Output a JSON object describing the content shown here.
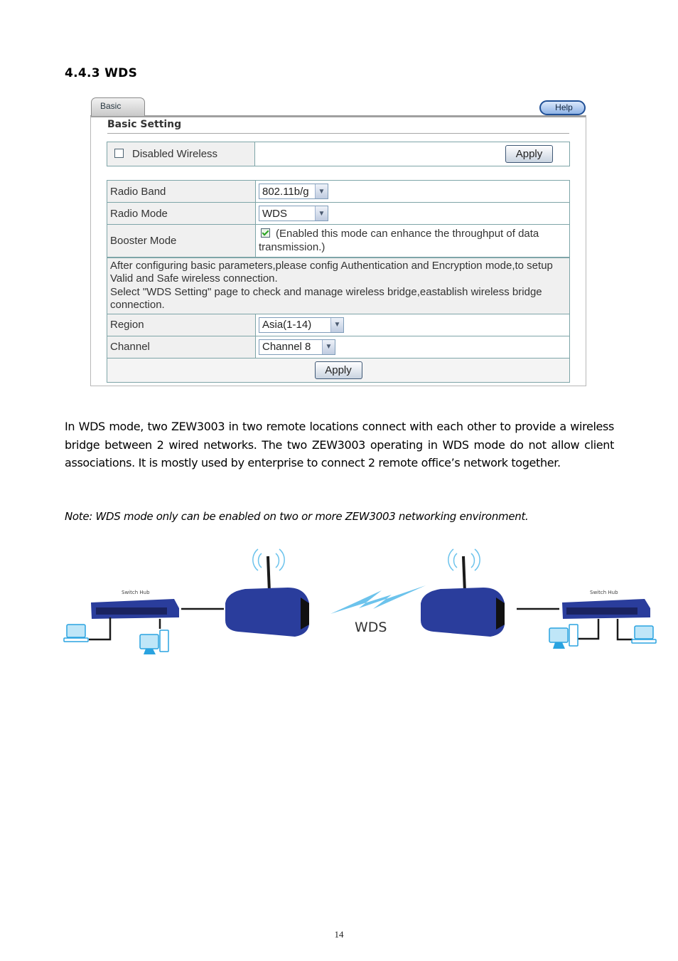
{
  "document": {
    "heading": "4.4.3 WDS",
    "page_number": "14"
  },
  "ui": {
    "tabs": [
      {
        "label": "Basic",
        "active": true
      }
    ],
    "help_label": "Help",
    "section_title": "Basic Setting",
    "disabled_wireless": {
      "label": "Disabled Wireless",
      "checked": false,
      "apply_label": "Apply"
    },
    "rows": {
      "radio_band": {
        "label": "Radio Band",
        "value": "802.11b/g"
      },
      "radio_mode": {
        "label": "Radio Mode",
        "value": "WDS"
      },
      "booster_mode": {
        "label": "Booster Mode",
        "checked": true,
        "description": "(Enabled this mode can enhance the throughput of data transmission.)"
      },
      "info_text_1": "After configuring basic parameters,please config Authentication and Encryption mode,to setup Valid and Safe wireless connection.",
      "info_text_2": "Select \"WDS Setting\" page to check and manage wireless bridge,eastablish wireless bridge connection.",
      "region": {
        "label": "Region",
        "value": "Asia(1-14)"
      },
      "channel": {
        "label": "Channel",
        "value": "Channel 8"
      }
    },
    "apply_label": "Apply"
  },
  "text": {
    "paragraph": "In WDS mode, two ZEW3003 in two remote locations connect with each other to provide a wireless bridge between 2 wired networks. The two ZEW3003 operating in WDS mode do not allow client associations. It is mostly used by enterprise to connect 2 remote office’s network together.",
    "note": "Note: WDS mode only can be enabled on two or more ZEW3003 networking environment."
  },
  "diagram": {
    "left_hub_label": "Switch Hub",
    "right_hub_label": "Switch Hub",
    "link_label": "WDS",
    "colors": {
      "device_blue": "#2a3d9c",
      "link_blue": "#6cc3ec",
      "cable": "#1a1a1a"
    }
  }
}
